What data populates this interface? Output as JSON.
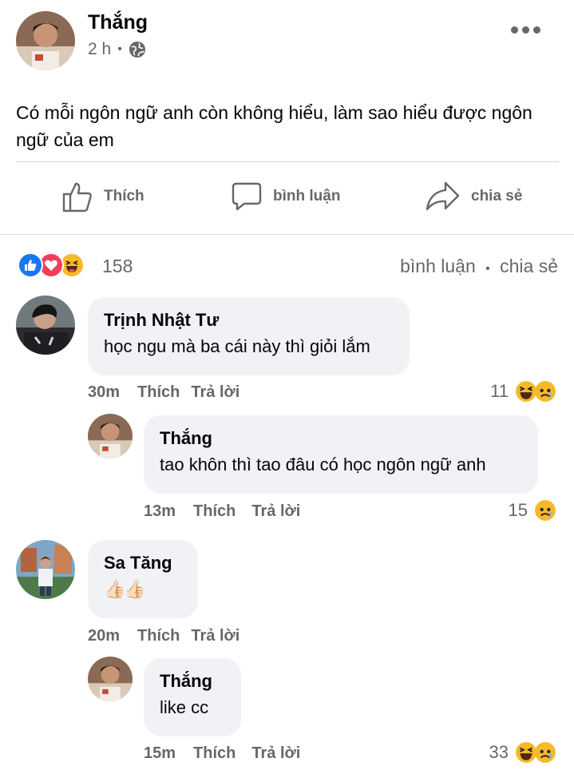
{
  "post": {
    "author": "Thắng",
    "time": "2 h",
    "dot": "•",
    "text": "Có mỗi ngôn ngữ anh còn không hiểu, làm sao hiểu được ngôn ngữ của em",
    "actions": {
      "like": "Thích",
      "comment": "bình luận",
      "share": "chia sẻ"
    },
    "reaction_count": "158",
    "meta_comment": "bình luận",
    "meta_dot": "•",
    "meta_share": "chia sẻ"
  },
  "comments": [
    {
      "name": "Trịnh Nhật Tư",
      "text": "học ngu mà ba cái này thì giỏi lắm",
      "time": "30m",
      "like": "Thích",
      "reply": "Trả lời",
      "count": "11",
      "reactions": [
        "haha-icon",
        "sad-icon"
      ]
    },
    {
      "name": "Thắng",
      "text": "tao khôn thì tao đâu có học ngôn ngữ anh",
      "time": "13m",
      "like": "Thích",
      "reply": "Trả lời",
      "count": "15",
      "reactions": [
        "sad-icon"
      ]
    },
    {
      "name": "Sa Tăng",
      "text": "👍🏻👍🏻",
      "time": "20m",
      "like": "Thích",
      "reply": "Trả lời",
      "count": "",
      "reactions": []
    },
    {
      "name": "Thắng",
      "text": "like cc",
      "time": "15m",
      "like": "Thích",
      "reply": "Trả lời",
      "count": "33",
      "reactions": [
        "haha-icon",
        "sad-icon"
      ]
    }
  ],
  "colors": {
    "like_blue": "#1877f2",
    "love_red": "#f33e58",
    "haha_yellow": "#f7b928",
    "secondary_text": "#65676b",
    "bubble_bg": "#f0f2f5"
  }
}
